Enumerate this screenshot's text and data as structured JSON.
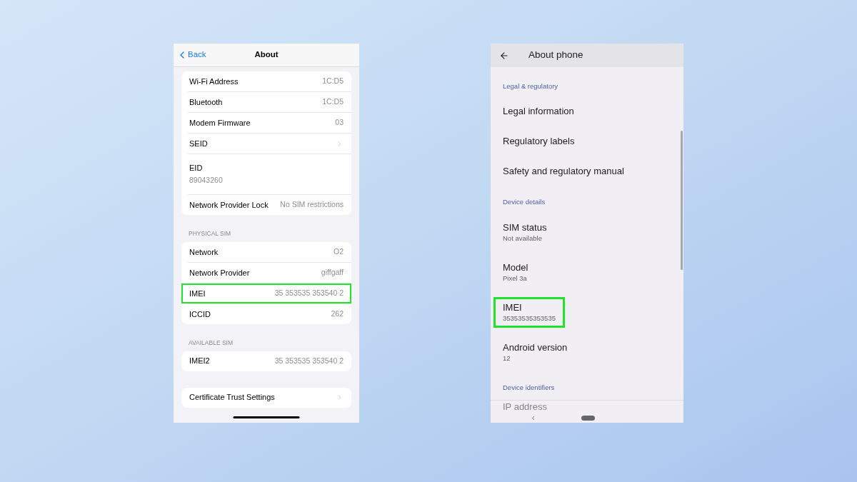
{
  "iphone": {
    "back": "Back",
    "title": "About",
    "groups": [
      {
        "rows": [
          {
            "kind": "value",
            "label": "Wi-Fi Address",
            "value": "1C:D5",
            "highlighted": false
          },
          {
            "kind": "value",
            "label": "Bluetooth",
            "value": "1C:D5",
            "highlighted": false
          },
          {
            "kind": "value",
            "label": "Modem Firmware",
            "value": "03",
            "highlighted": false
          },
          {
            "kind": "chevron",
            "label": "SEID",
            "highlighted": false
          },
          {
            "kind": "stacked",
            "label": "EID",
            "value": "89043260",
            "highlighted": false
          },
          {
            "kind": "value",
            "label": "Network Provider Lock",
            "value": "No SIM restrictions",
            "highlighted": false
          }
        ]
      },
      {
        "header": "PHYSICAL SIM",
        "rows": [
          {
            "kind": "value",
            "label": "Network",
            "value": "O2",
            "highlighted": false
          },
          {
            "kind": "value",
            "label": "Network Provider",
            "value": "giffgaff",
            "highlighted": false
          },
          {
            "kind": "value",
            "label": "IMEI",
            "value": "35 353535 353540 2",
            "highlighted": true
          },
          {
            "kind": "value",
            "label": "ICCID",
            "value": "262",
            "highlighted": false
          }
        ]
      },
      {
        "header": "AVAILABLE SIM",
        "rows": [
          {
            "kind": "value",
            "label": "IMEI2",
            "value": "35 353535 353540 2",
            "highlighted": false
          }
        ]
      },
      {
        "rows": [
          {
            "kind": "chevron",
            "label": "Certificate Trust Settings",
            "highlighted": false
          }
        ]
      }
    ]
  },
  "android": {
    "title": "About phone",
    "sections": [
      {
        "header": "Legal & regulatory",
        "items": [
          {
            "title": "Legal information",
            "highlighted": false
          },
          {
            "title": "Regulatory labels",
            "highlighted": false
          },
          {
            "title": "Safety and regulatory manual",
            "highlighted": false
          }
        ]
      },
      {
        "header": "Device details",
        "items": [
          {
            "title": "SIM status",
            "summary": "Not available",
            "highlighted": false
          },
          {
            "title": "Model",
            "summary": "Pixel 3a",
            "highlighted": false
          },
          {
            "title": "IMEI",
            "summary": "35353535353535",
            "highlighted": true
          },
          {
            "title": "Android version",
            "summary": "12",
            "highlighted": false
          }
        ]
      },
      {
        "header": "Device identifiers",
        "items": [
          {
            "title": "IP address",
            "highlighted": false
          }
        ]
      }
    ]
  }
}
